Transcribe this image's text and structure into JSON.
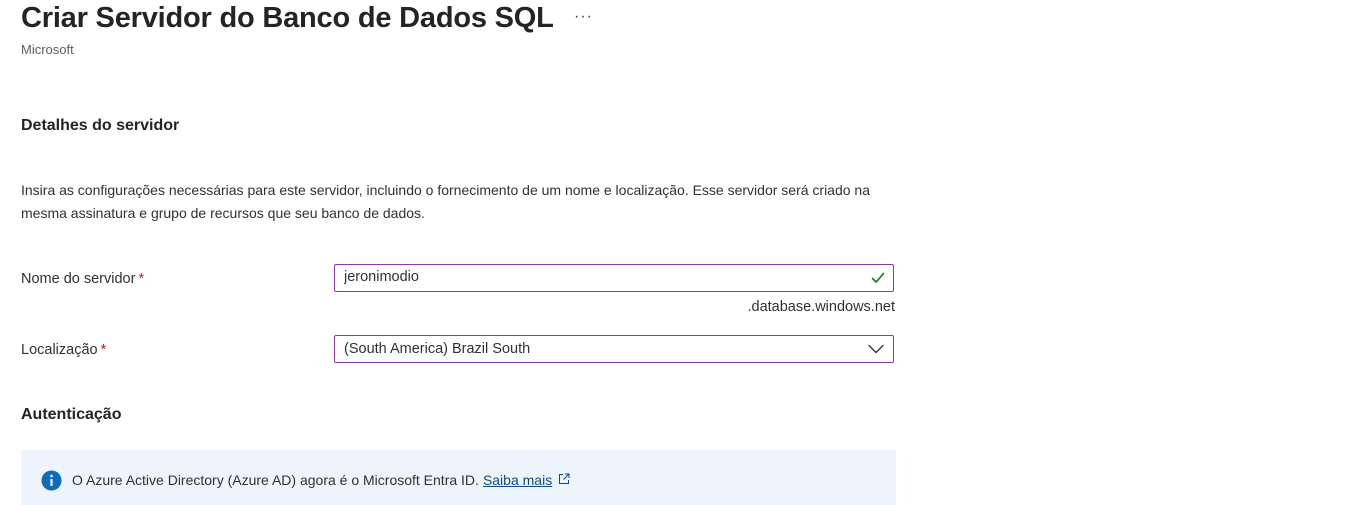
{
  "header": {
    "title": "Criar Servidor do Banco de Dados SQL",
    "more_label": "···",
    "publisher": "Microsoft"
  },
  "server_details": {
    "heading": "Detalhes do servidor",
    "description": "Insira as configurações necessárias para este servidor, incluindo o fornecimento de um nome e localização. Esse servidor será criado na mesma assinatura e grupo de recursos que seu banco de dados."
  },
  "server_name": {
    "label": "Nome do servidor",
    "required_mark": "*",
    "value": "jeronimodio",
    "suffix": ".database.windows.net",
    "valid_icon": "checkmark-icon",
    "valid_color": "#107c10"
  },
  "location": {
    "label": "Localização",
    "required_mark": "*",
    "selected": "(South America) Brazil South",
    "dropdown_icon": "chevron-down-icon"
  },
  "authentication": {
    "heading": "Autenticação",
    "info_icon": "info-icon",
    "info_text": "O Azure Active Directory (Azure AD) agora é o Microsoft Entra ID.",
    "link_label": "Saiba mais",
    "link_icon": "external-link-icon"
  },
  "colors": {
    "accent_border": "#8a3aa5",
    "info_background": "#eef4fc",
    "info_icon": "#0f6cbd",
    "link": "#0f4a87",
    "required": "#a4262c"
  }
}
